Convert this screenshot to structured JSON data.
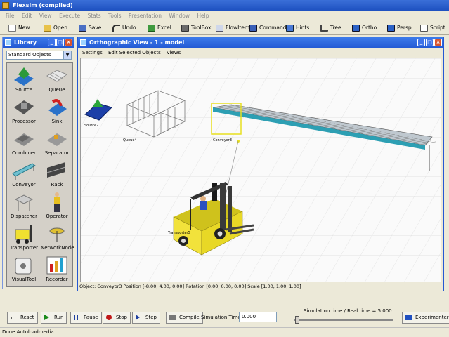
{
  "app": {
    "title": "Flexsim (compiled)"
  },
  "menubar": [
    "File",
    "Edit",
    "View",
    "Execute",
    "Stats",
    "Tools",
    "Presentation",
    "Window",
    "Help"
  ],
  "toolbar": {
    "new": "New",
    "open": "Open",
    "save": "Save",
    "undo": "Undo",
    "excel": "Excel",
    "toolbox": "ToolBox",
    "flowitem": "FlowItem",
    "commands": "Commands",
    "hints": "Hints",
    "tree": "Tree",
    "ortho": "Ortho",
    "persp": "Persp",
    "script": "Script"
  },
  "library": {
    "title": "Library",
    "selected": "Standard Objects",
    "items": [
      "Source",
      "Queue",
      "Processor",
      "Sink",
      "Combiner",
      "Separator",
      "Conveyor",
      "Rack",
      "Dispatcher",
      "Operator",
      "Transporter",
      "NetworkNode",
      "VisualTool",
      "Recorder"
    ]
  },
  "view": {
    "title": "Orthographic View - 1 - model",
    "menu": {
      "settings": "Settings",
      "edit_selected": "Edit Selected Objects",
      "views": "Views"
    },
    "status": "Object: Conveyor3 Position [-8.00, 4.00, 0.00]  Rotation [0.00, 0.00, 0.00]  Scale [1.00, 1.00, 1.00]",
    "labels": {
      "source": "Source2",
      "queue": "Queue4",
      "conveyor": "Conveyor3",
      "transporter": "Transporter5"
    }
  },
  "controls": {
    "reset": "Reset",
    "run": "Run",
    "pause": "Pause",
    "stop": "Stop",
    "step": "Step",
    "compile": "Compile",
    "sim_time_label": "Simulation Time:",
    "sim_time_value": "0.000",
    "ratio_label": "Simulation time / Real time =",
    "ratio_value": "5.000",
    "experimenter": "Experimenter"
  },
  "statusbar": {
    "text": "Done Autoloadmedia."
  },
  "colors": {
    "titlebar": "#2258d3",
    "accent": "#3d7bea",
    "conveyor": "#3fa8b8",
    "forklift": "#f2e23b"
  }
}
